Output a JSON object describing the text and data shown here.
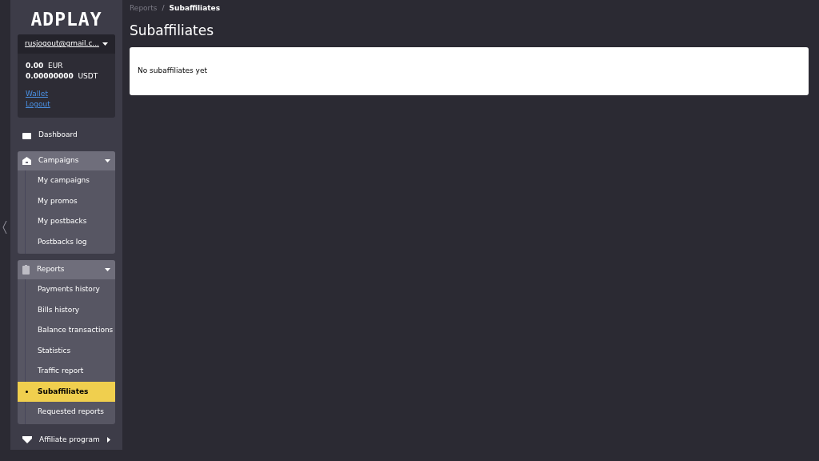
{
  "logo": "ADPLAY",
  "account": {
    "email": "rusjogout@gmail.c...",
    "balances": [
      {
        "amount": "0.00",
        "currency": "EUR"
      },
      {
        "amount": "0.00000000",
        "currency": "USDT"
      }
    ],
    "links": [
      "Wallet",
      "Logout"
    ]
  },
  "sidebar": {
    "items": [
      {
        "kind": "link",
        "label": "Dashboard"
      },
      {
        "kind": "group",
        "label": "Campaigns",
        "expanded": true,
        "children": [
          {
            "label": "My campaigns",
            "selected": false
          },
          {
            "label": "My promos",
            "selected": false
          },
          {
            "label": "My postbacks",
            "selected": false
          },
          {
            "label": "Postbacks log",
            "selected": false
          }
        ]
      },
      {
        "kind": "group",
        "label": "Reports",
        "expanded": true,
        "children": [
          {
            "label": "Payments history",
            "selected": false
          },
          {
            "label": "Bills history",
            "selected": false
          },
          {
            "label": "Balance transactions",
            "selected": false
          },
          {
            "label": "Statistics",
            "selected": false
          },
          {
            "label": "Traffic report",
            "selected": false
          },
          {
            "label": "Subaffiliates",
            "selected": true
          },
          {
            "label": "Requested reports",
            "selected": false
          }
        ]
      },
      {
        "kind": "group",
        "label": "Affiliate program",
        "expanded": false
      }
    ]
  },
  "breadcrumb_separator": "/",
  "breadcrumb": [
    {
      "label": "Reports",
      "current": false
    },
    {
      "label": "Subaffiliates",
      "current": true
    }
  ],
  "page_title": "Subaffiliates",
  "empty_message": "No subaffiliates yet"
}
